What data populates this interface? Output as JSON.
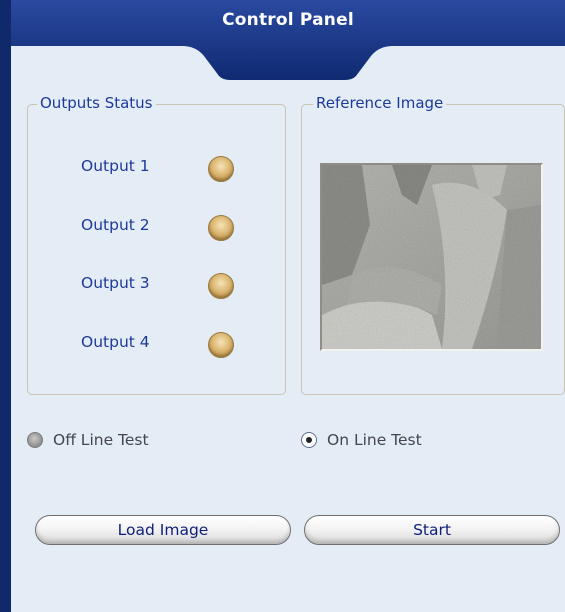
{
  "header": {
    "title": "Control Panel"
  },
  "outputs_status": {
    "title": "Outputs Status",
    "outputs": [
      {
        "label": "Output 1",
        "state": "off"
      },
      {
        "label": "Output 2",
        "state": "off"
      },
      {
        "label": "Output 3",
        "state": "off"
      },
      {
        "label": "Output 4",
        "state": "off"
      }
    ]
  },
  "reference_image": {
    "title": "Reference Image"
  },
  "test_mode": {
    "options": [
      {
        "label": "Off Line Test",
        "selected": false
      },
      {
        "label": "On Line Test",
        "selected": true
      }
    ]
  },
  "buttons": {
    "load_image": "Load Image",
    "start": "Start"
  },
  "colors": {
    "header_bg": "#17317c",
    "panel_bg": "#e4ecf5",
    "label_text": "#1d3a9a",
    "led_off": "#d8b36c"
  }
}
